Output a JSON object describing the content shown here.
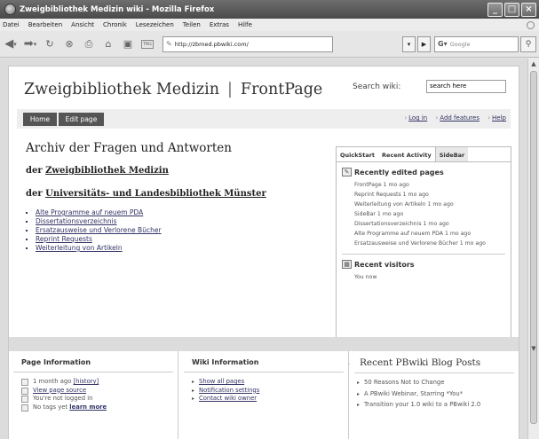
{
  "window": {
    "title": "Zweigbibliothek Medizin wiki - Mozilla Firefox",
    "minimize": "_",
    "maximize": "□",
    "close": "×"
  },
  "menu": [
    "Datei",
    "Bearbeiten",
    "Ansicht",
    "Chronik",
    "Lesezeichen",
    "Teilen",
    "Extras",
    "Hilfe"
  ],
  "toolbar": {
    "url": "http://zbmed.pbwiki.com/",
    "search_placeholder": "Google",
    "tag_label": "TAG"
  },
  "wiki": {
    "name": "Zweigbibliothek Medizin",
    "page_name": "FrontPage",
    "search_label": "Search wiki:",
    "search_value": "search here",
    "tabs": {
      "home": "Home",
      "edit": "Edit page"
    },
    "links": {
      "login": "Log in",
      "add_features": "Add features",
      "help": "Help"
    }
  },
  "content": {
    "heading": "Archiv der Fragen und Antworten",
    "line2_prefix": "der ",
    "line2_link": "Zweigbibliothek Medizin",
    "line3_prefix": "der ",
    "line3_link": "Universitäts- und Landesbibliothek Münster",
    "list": [
      "Alte Programme auf neuem PDA",
      "Dissertationsverzeichnis",
      "Ersatzausweise und Verlorene Bücher",
      "Reprint Requests",
      "Weiterleitung von Artikeln"
    ]
  },
  "sidebar": {
    "tabs": [
      "QuickStart",
      "Recent Activity",
      "SideBar"
    ],
    "recent_heading": "Recently edited pages",
    "recent_items": [
      "FrontPage 1 mo ago",
      "Reprint Requests 1 mo ago",
      "Weiterleitung von Artikeln 1 mo ago",
      "SideBar 1 mo ago",
      "Dissertationsverzeichnis 1 mo ago",
      "Alte Programme auf neuem PDA 1 mo ago",
      "Ersatzausweise und Verlorene Bücher 1 mo ago"
    ],
    "visitors_heading": "Recent visitors",
    "visitors_item": "You now"
  },
  "page_info": {
    "heading": "Page Information",
    "updated_prefix": "1 month ago",
    "history": "[history]",
    "view_source": "View page source",
    "not_logged": "You're not logged in",
    "no_tags": "No tags yet",
    "learn_more": "learn more"
  },
  "wiki_info": {
    "heading": "Wiki Information",
    "links": [
      "Show all pages",
      "Notification settings",
      "Contact wiki owner"
    ]
  },
  "blog": {
    "heading": "Recent PBwiki Blog Posts",
    "posts": [
      "50 Reasons Not to Change",
      "A PBwiki Webinar, Starring *You*",
      "Transition your 1.0 wiki to a PBwiki 2.0"
    ]
  }
}
